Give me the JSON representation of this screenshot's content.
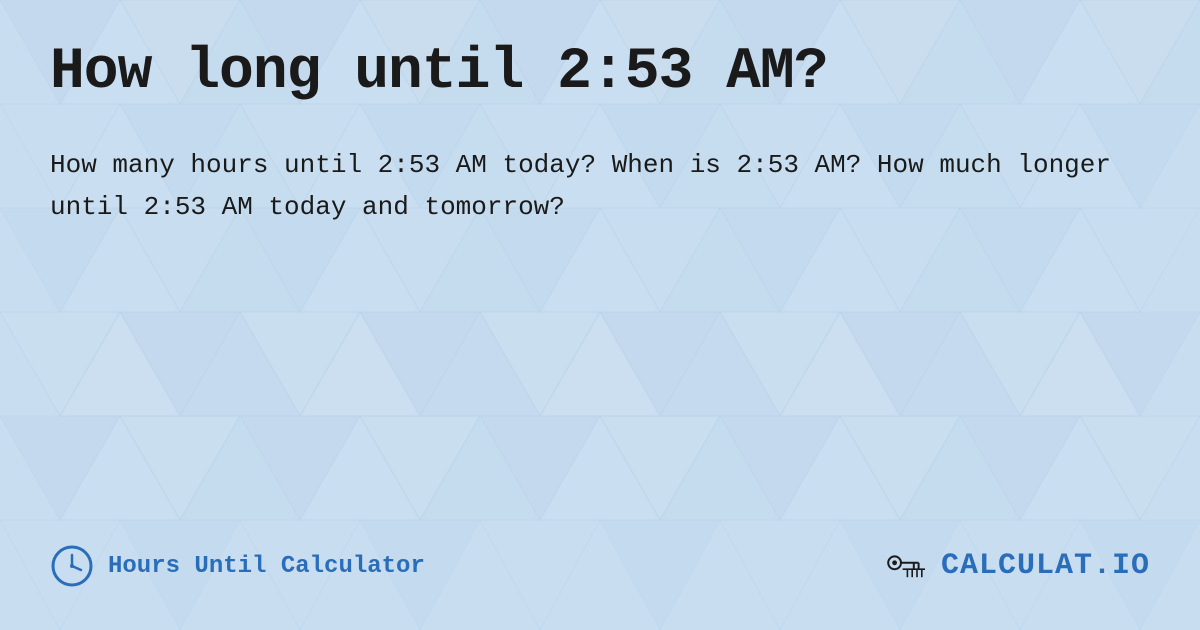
{
  "page": {
    "title": "How long until 2:53 AM?",
    "description": "How many hours until 2:53 AM today? When is 2:53 AM? How much longer until 2:53 AM today and tomorrow?",
    "footer": {
      "label": "Hours Until Calculator",
      "logo_text": "CALCULAT.IO"
    },
    "bg_color": "#c8ddf0",
    "accent_color": "#2a6eba"
  }
}
